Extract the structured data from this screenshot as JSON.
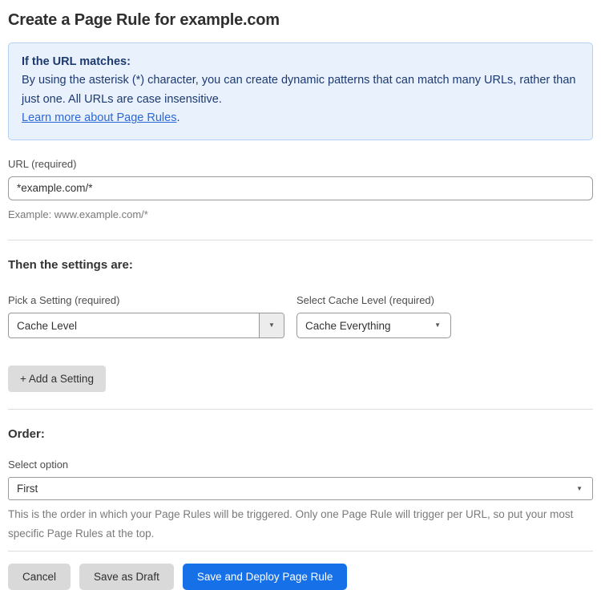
{
  "page": {
    "title": "Create a Page Rule for example.com"
  },
  "info_box": {
    "heading": "If the URL matches:",
    "body": "By using the asterisk (*) character, you can create dynamic patterns that can match many URLs, rather than just one. All URLs are case insensitive.",
    "link_label": "Learn more about Page Rules",
    "link_suffix": "."
  },
  "url_section": {
    "label": "URL (required)",
    "value": "*example.com/*",
    "helper": "Example: www.example.com/*"
  },
  "settings_section": {
    "heading": "Then the settings are:",
    "setting_label": "Pick a Setting (required)",
    "setting_value": "Cache Level",
    "cache_label": "Select Cache Level (required)",
    "cache_value": "Cache Everything",
    "add_button_label": "+ Add a Setting"
  },
  "order_section": {
    "heading": "Order:",
    "label": "Select option",
    "value": "First",
    "helper": "This is the order in which your Page Rules will be triggered. Only one Page Rule will trigger per URL, so put your most specific Page Rules at the top."
  },
  "actions": {
    "cancel_label": "Cancel",
    "save_draft_label": "Save as Draft",
    "save_deploy_label": "Save and Deploy Page Rule"
  },
  "icons": {
    "dropdown_caret": "▼"
  },
  "colors": {
    "info_bg": "#e9f1fc",
    "info_border": "#b3d1f0",
    "info_text": "#1d3a70",
    "link": "#2d68d8",
    "primary_button": "#1670e8",
    "gray_button": "#d9d9d9"
  }
}
